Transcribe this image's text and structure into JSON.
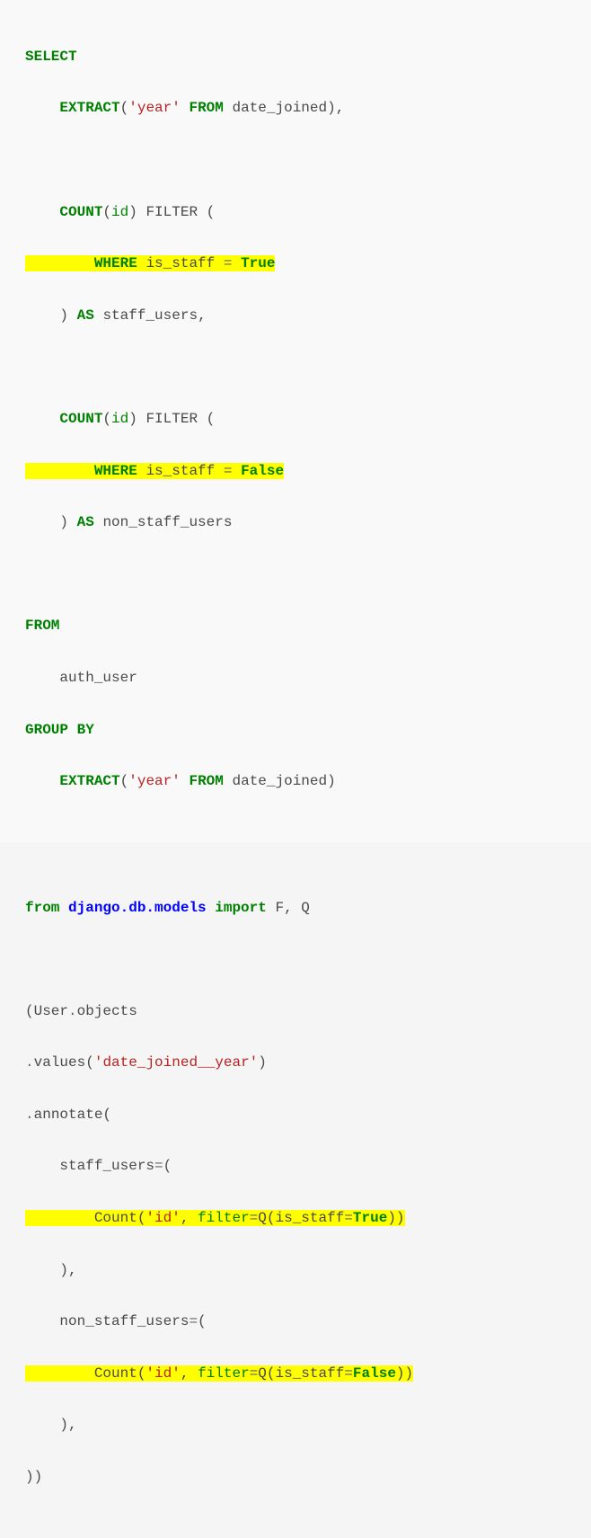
{
  "sql": {
    "select": "SELECT",
    "extract1_open": "EXTRACT",
    "extract1_p1": "(",
    "extract1_q1": "'",
    "extract1_year": "year",
    "extract1_q2": "'",
    "extract1_from": "FROM",
    "extract1_col": "date_joined",
    "extract1_close": "),",
    "count1": "COUNT",
    "count1_p1": "(",
    "count1_id": "id",
    "count1_p2": ")",
    "count1_filter": "FILTER",
    "count1_p3": "(",
    "where1_pad": "        ",
    "where1": "WHERE",
    "where1_col": "is_staff",
    "where1_eq": "=",
    "where1_val": "True",
    "count1_p4": ")",
    "as1": "AS",
    "staff_users": "staff_users",
    "comma1": ",",
    "count2": "COUNT",
    "count2_p1": "(",
    "count2_id": "id",
    "count2_p2": ")",
    "count2_filter": "FILTER",
    "count2_p3": "(",
    "where2_pad": "        ",
    "where2": "WHERE",
    "where2_col": "is_staff",
    "where2_eq": "=",
    "where2_val": "False",
    "count2_p4": ")",
    "as2": "AS",
    "non_staff_users": "non_staff_users",
    "from": "FROM",
    "auth_user": "auth_user",
    "group_by": "GROUP BY",
    "extract2_open": "EXTRACT",
    "extract2_p1": "(",
    "extract2_q1": "'",
    "extract2_year": "year",
    "extract2_q2": "'",
    "extract2_from": "FROM",
    "extract2_col": "date_joined",
    "extract2_close": ")"
  },
  "py": {
    "from": "from",
    "module": "django.db.models",
    "import": "import",
    "f": "F",
    "comma_fq": ",",
    "q": "Q",
    "user_objects_open": "(User",
    "dot1": ".",
    "objects": "objects",
    "dot_values": ".",
    "values": "values(",
    "values_q1": "'",
    "values_str": "date_joined__year",
    "values_q2": "'",
    "values_close": ")",
    "dot_annotate": ".",
    "annotate": "annotate(",
    "staff_users_kw": "staff_users",
    "eq1": "=",
    "paren1": "(",
    "c1_pad": "        ",
    "c1_count": "Count(",
    "c1_q1": "'",
    "c1_id": "id",
    "c1_q2": "'",
    "c1_comma": ",",
    "c1_filter": "filter",
    "c1_eq": "=",
    "c1_q": "Q(is_staff",
    "c1_eq2": "=",
    "c1_true": "True",
    "c1_close": "))",
    "paren1_close": "),",
    "non_staff_users_kw": "non_staff_users",
    "eq2": "=",
    "paren2": "(",
    "c2_pad": "        ",
    "c2_count": "Count(",
    "c2_q1": "'",
    "c2_id": "id",
    "c2_q2": "'",
    "c2_comma": ",",
    "c2_filter": "filter",
    "c2_eq": "=",
    "c2_q": "Q(is_staff",
    "c2_eq2": "=",
    "c2_false": "False",
    "c2_close": "))",
    "paren2_close": "),",
    "close_all": "))"
  }
}
